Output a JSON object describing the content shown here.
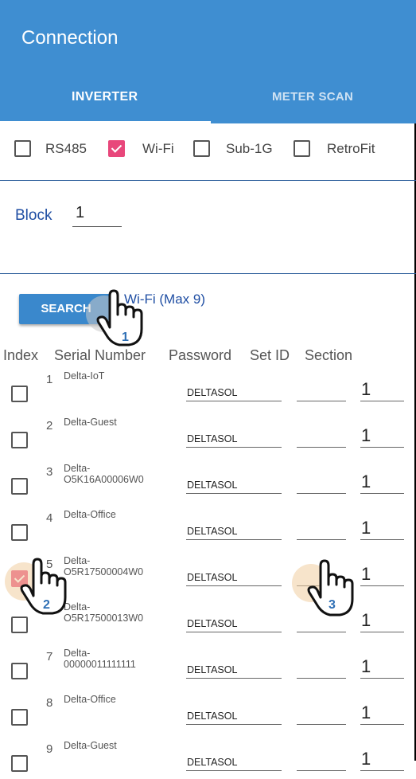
{
  "header": {
    "title": "Connection",
    "tabs": [
      {
        "label": "INVERTER",
        "active": true
      },
      {
        "label": "METER SCAN",
        "active": false
      }
    ]
  },
  "interfaces": [
    {
      "label": "RS485",
      "checked": false
    },
    {
      "label": "Wi-Fi",
      "checked": true
    },
    {
      "label": "Sub-1G",
      "checked": false
    },
    {
      "label": "RetroFit",
      "checked": false
    }
  ],
  "block": {
    "label": "Block",
    "value": "1"
  },
  "search": {
    "button_label": "SEARCH",
    "wifi_label": "Wi-Fi (Max 9)"
  },
  "columns": [
    "Index",
    "Serial Number",
    "Password",
    "Set ID",
    "Section"
  ],
  "rows": [
    {
      "index": "1",
      "serial": "Delta-IoT",
      "password": "DELTASOL",
      "set_id": "",
      "section": "1",
      "checked": false
    },
    {
      "index": "2",
      "serial": "Delta-Guest",
      "password": "DELTASOL",
      "set_id": "",
      "section": "1",
      "checked": false
    },
    {
      "index": "3",
      "serial": "Delta-\nO5K16A00006W0",
      "password": "DELTASOL",
      "set_id": "",
      "section": "1",
      "checked": false
    },
    {
      "index": "4",
      "serial": "Delta-Office",
      "password": "DELTASOL",
      "set_id": "",
      "section": "1",
      "checked": false
    },
    {
      "index": "5",
      "serial": "Delta-\nO5R17500004W0",
      "password": "DELTASOL",
      "set_id": "",
      "section": "1",
      "checked": true
    },
    {
      "index": "6",
      "serial": "Delta-\nO5R17500013W0",
      "password": "DELTASOL",
      "set_id": "",
      "section": "1",
      "checked": false
    },
    {
      "index": "7",
      "serial": "Delta-\n00000011111111",
      "password": "DELTASOL",
      "set_id": "",
      "section": "1",
      "checked": false
    },
    {
      "index": "8",
      "serial": "Delta-Office",
      "password": "DELTASOL",
      "set_id": "",
      "section": "1",
      "checked": false
    },
    {
      "index": "9",
      "serial": "Delta-Guest",
      "password": "DELTASOL",
      "set_id": "",
      "section": "1",
      "checked": false
    }
  ],
  "steps": [
    "1",
    "2",
    "3"
  ],
  "colors": {
    "header": "#3f8ed1",
    "accent_blue": "#1f4ea3",
    "checkbox_checked": "#e8477b",
    "button": "#3a88cc"
  }
}
